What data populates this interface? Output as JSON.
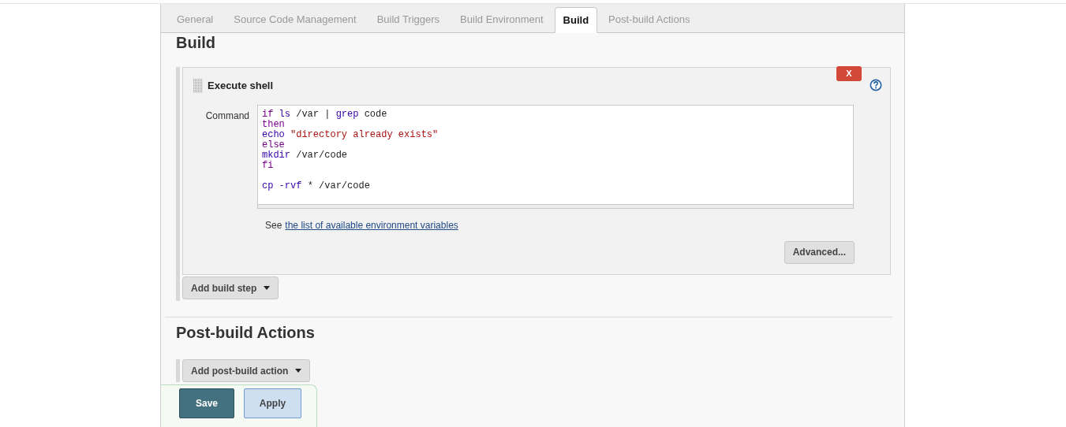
{
  "tabs": [
    {
      "label": "General",
      "selected": false
    },
    {
      "label": "Source Code Management",
      "selected": false
    },
    {
      "label": "Build Triggers",
      "selected": false
    },
    {
      "label": "Build Environment",
      "selected": false
    },
    {
      "label": "Build",
      "selected": true
    },
    {
      "label": "Post-build Actions",
      "selected": false
    }
  ],
  "build": {
    "heading": "Build",
    "step": {
      "title": "Execute shell",
      "delete_label": "X",
      "command_label": "Command",
      "lines": [
        {
          "kind": "code",
          "tokens": [
            {
              "text": "if",
              "kind": "keyword"
            },
            {
              "text": "ls",
              "kind": "builtin"
            },
            {
              "text": "/var |",
              "kind": "plain"
            },
            {
              "text": "grep",
              "kind": "builtin"
            },
            {
              "text": "code",
              "kind": "plain"
            }
          ]
        },
        {
          "kind": "code",
          "tokens": [
            {
              "text": "then",
              "kind": "keyword"
            }
          ]
        },
        {
          "kind": "code",
          "tokens": [
            {
              "text": "echo",
              "kind": "builtin"
            },
            {
              "text": "\"directory already exists\"",
              "kind": "string"
            }
          ]
        },
        {
          "kind": "code",
          "tokens": [
            {
              "text": "else",
              "kind": "keyword"
            }
          ]
        },
        {
          "kind": "code",
          "tokens": [
            {
              "text": "mkdir",
              "kind": "builtin"
            },
            {
              "text": "/var/code",
              "kind": "plain"
            }
          ]
        },
        {
          "kind": "code",
          "tokens": [
            {
              "text": "fi",
              "kind": "keyword"
            }
          ]
        },
        {
          "kind": "blank"
        },
        {
          "kind": "code",
          "tokens": [
            {
              "text": "cp",
              "kind": "builtin"
            },
            {
              "text": "-rvf",
              "kind": "builtin"
            },
            {
              "text": "* /var/code",
              "kind": "plain"
            }
          ]
        }
      ],
      "see_text": "See",
      "see_link": "the list of available environment variables",
      "advanced_button": "Advanced..."
    },
    "add_button": "Add build step"
  },
  "post_build": {
    "heading": "Post-build Actions",
    "add_button": "Add post-build action"
  },
  "footer": {
    "save": "Save",
    "apply": "Apply"
  }
}
